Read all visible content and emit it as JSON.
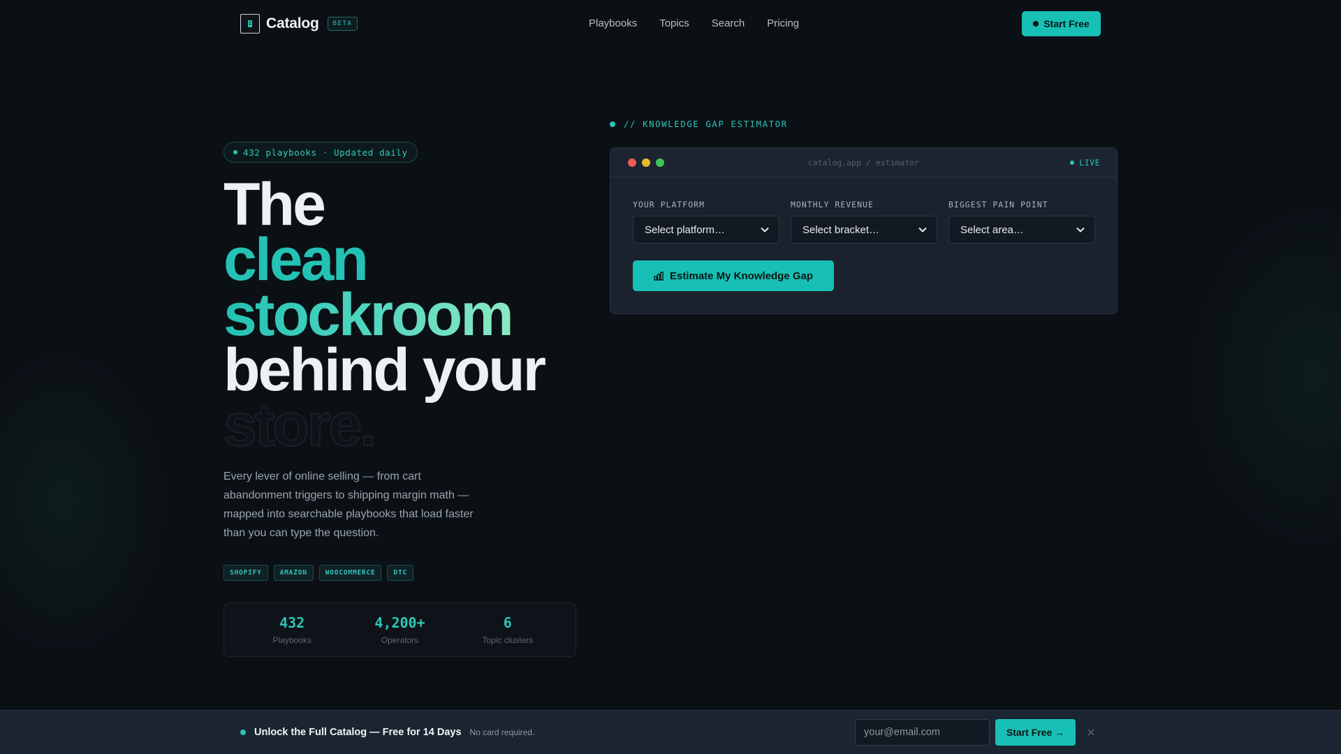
{
  "nav": {
    "logo_text": "Catalog",
    "logo_icon": "book-box-icon",
    "beta_badge": "BETA",
    "links": [
      "Playbooks",
      "Topics",
      "Search",
      "Pricing"
    ],
    "cta_label": "Start Free"
  },
  "hero": {
    "pill_text": "432 playbooks · Updated daily",
    "headline": [
      "The",
      "clean",
      "stockroom",
      "behind your",
      "store."
    ],
    "description": "Every lever of online selling — from cart abandonment triggers to shipping margin math — mapped into searchable playbooks that load faster than you can type the question.",
    "tags": [
      "SHOPIFY",
      "AMAZON",
      "WOOCOMMERCE",
      "DTC"
    ],
    "stats": [
      {
        "value": "432",
        "label": "Playbooks"
      },
      {
        "value": "4,200+",
        "label": "Operators"
      },
      {
        "value": "6",
        "label": "Topic clusters"
      }
    ]
  },
  "estimator": {
    "section_title": "// KNOWLEDGE GAP ESTIMATOR",
    "url": "catalog.app / estimator",
    "live_label": "LIVE",
    "fields": [
      {
        "label": "YOUR PLATFORM",
        "value": "Select platform…"
      },
      {
        "label": "MONTHLY REVENUE",
        "value": "Select bracket…"
      },
      {
        "label": "BIGGEST PAIN POINT",
        "value": "Select area…"
      }
    ],
    "button_label": "Estimate My Knowledge Gap",
    "button_icon": "bar-chart-icon"
  },
  "banner": {
    "title": "Unlock the Full Catalog — Free for 14 Days",
    "subtitle": "No card required.",
    "email_placeholder": "your@email.com",
    "cta_label": "Start Free →",
    "close_icon": "close-icon"
  },
  "colors": {
    "accent": "#17bfb4",
    "background": "#0b1015",
    "panel": "#1a222d",
    "traffic_red": "#ed5b52",
    "traffic_yellow": "#e9b92f",
    "traffic_green": "#3cc65a"
  }
}
